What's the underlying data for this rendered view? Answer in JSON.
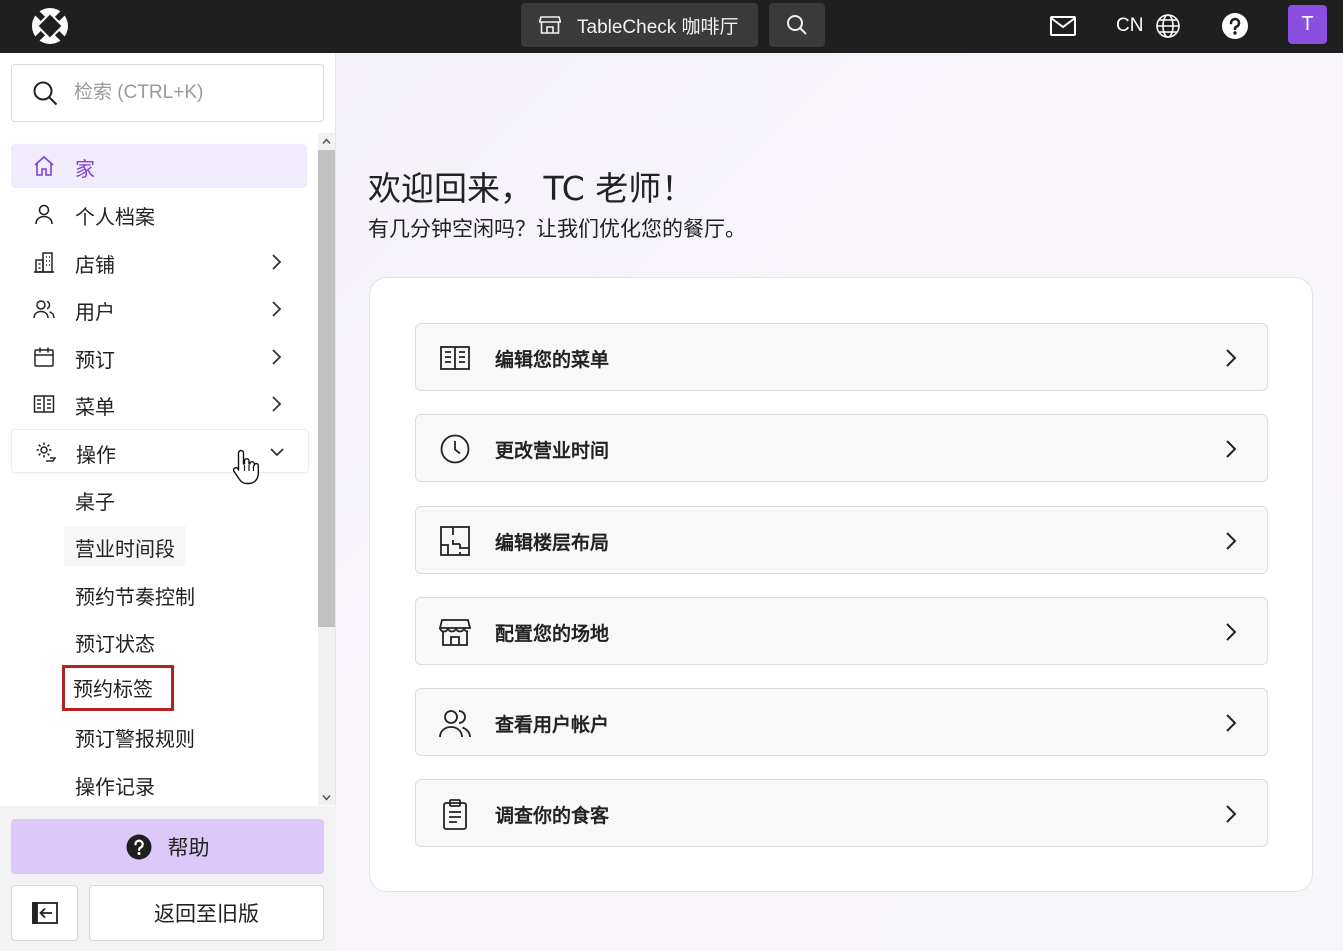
{
  "topbar": {
    "venue_name": "TableCheck 咖啡厅",
    "language": "CN",
    "avatar_initial": "T"
  },
  "sidebar": {
    "search_placeholder": "检索 (CTRL+K)",
    "items": [
      {
        "label": "家"
      },
      {
        "label": "个人档案"
      },
      {
        "label": "店铺"
      },
      {
        "label": "用户"
      },
      {
        "label": "预订"
      },
      {
        "label": "菜单"
      },
      {
        "label": "操作"
      }
    ],
    "sub_items": [
      {
        "label": "桌子"
      },
      {
        "label": "营业时间段"
      },
      {
        "label": "预约节奏控制"
      },
      {
        "label": "预订状态"
      },
      {
        "label": "预约标签"
      },
      {
        "label": "预订警报规则"
      },
      {
        "label": "操作记录"
      }
    ],
    "help_label": "帮助",
    "legacy_label": "返回至旧版"
  },
  "main": {
    "welcome": "欢迎回来， TC 老师！",
    "subtitle": "有几分钟空闲吗？让我们优化您的餐厅。",
    "actions": [
      {
        "label": "编辑您的菜单",
        "icon": "menu-book-icon"
      },
      {
        "label": "更改营业时间",
        "icon": "clock-icon"
      },
      {
        "label": "编辑楼层布局",
        "icon": "floor-plan-icon"
      },
      {
        "label": "配置您的场地",
        "icon": "storefront-icon"
      },
      {
        "label": "查看用户帐户",
        "icon": "users-icon"
      },
      {
        "label": "调查你的食客",
        "icon": "clipboard-icon"
      }
    ]
  },
  "colors": {
    "topbar_bg": "#1f1f1f",
    "accent": "#7a42d6",
    "avatar_bg": "#8a4fe0",
    "help_bg": "#dcc9f7",
    "highlight_border": "#b22222"
  }
}
